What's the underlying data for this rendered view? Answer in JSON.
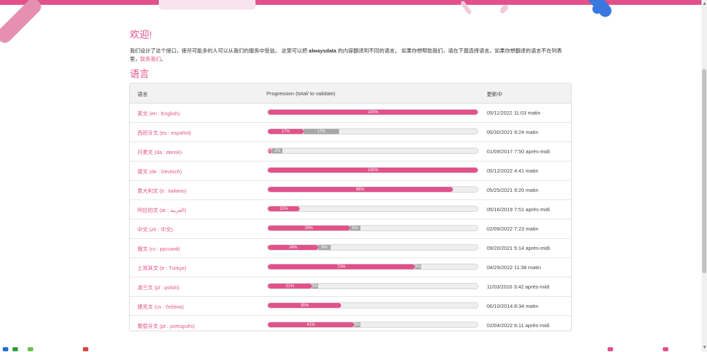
{
  "welcome_title": "欢迎!",
  "intro": {
    "text_a": "我们设计了这个接口，使尽可能多的人可以从我们的服务中受益。 这里可以把 ",
    "brand": "alwaysdata",
    "text_b": " 的内容翻译到不同的语言。 如果你想帮助我们，请在下面选择语言。如果你想翻译的语言不在列表里，",
    "contact_link": "联系我们",
    "text_c": "。"
  },
  "languages_title": "语言",
  "table": {
    "headers": {
      "language": "语言",
      "progression": "Progression (total/ to validate)",
      "updated": "更新中"
    },
    "rows": [
      {
        "language": "英文 (en : English)",
        "done": 100,
        "pending": 0,
        "done_label": "100%",
        "pending_label": "",
        "updated": "05/11/2022 11:03 matin"
      },
      {
        "language": "西班牙文 (es : español)",
        "done": 17,
        "pending": 17,
        "done_label": "17%",
        "pending_label": "17%",
        "updated": "06/30/2021 9:24 matin"
      },
      {
        "language": "丹麦文 (da : dansk)",
        "done": 2,
        "pending": 5,
        "done_label": "0%",
        "pending_label": "2%",
        "updated": "01/09/2017 7:50 après-midi"
      },
      {
        "language": "德文 (de : Deutsch)",
        "done": 100,
        "pending": 0,
        "done_label": "100%",
        "pending_label": "",
        "updated": "05/12/2022 4:41 matin"
      },
      {
        "language": "意大利文 (it : italiano)",
        "done": 88,
        "pending": 0,
        "done_label": "88%",
        "pending_label": "",
        "updated": "05/25/2021 9:20 matin"
      },
      {
        "language": "阿拉伯文 (ar : العربية)",
        "done": 15,
        "pending": 0,
        "done_label": "15%",
        "pending_label": "",
        "updated": "05/16/2019 7:51 après-midi"
      },
      {
        "language": "中文 (zh : 中文)",
        "done": 39,
        "pending": 5,
        "done_label": "39%",
        "pending_label": "5%",
        "updated": "02/09/2022 7:23 matin"
      },
      {
        "language": "俄文 (ru : русский)",
        "done": 24,
        "pending": 6,
        "done_label": "24%",
        "pending_label": "6%",
        "updated": "09/20/2021 5:14 après-midi"
      },
      {
        "language": "土耳其文 (tr : Türkçe)",
        "done": 70,
        "pending": 3,
        "done_label": "70%",
        "pending_label": "3%",
        "updated": "04/29/2022 11:38 matin"
      },
      {
        "language": "波兰文 (pl : polski)",
        "done": 21,
        "pending": 3,
        "done_label": "21%",
        "pending_label": "3%",
        "updated": "11/03/2016 3:42 après-midi"
      },
      {
        "language": "捷克文 (cs : čeština)",
        "done": 35,
        "pending": 0,
        "done_label": "35%",
        "pending_label": "",
        "updated": "06/10/2014 8:34 matin"
      },
      {
        "language": "葡萄牙文 (pt : português)",
        "done": 41,
        "pending": 3,
        "done_label": "41%",
        "pending_label": "3%",
        "updated": "02/04/2022 6:11 après-midi"
      }
    ]
  },
  "colors": {
    "accent": "#e2518a",
    "pending": "#a8a8a8",
    "track": "#eeeeee",
    "corner_blue": "#3a78e0"
  }
}
